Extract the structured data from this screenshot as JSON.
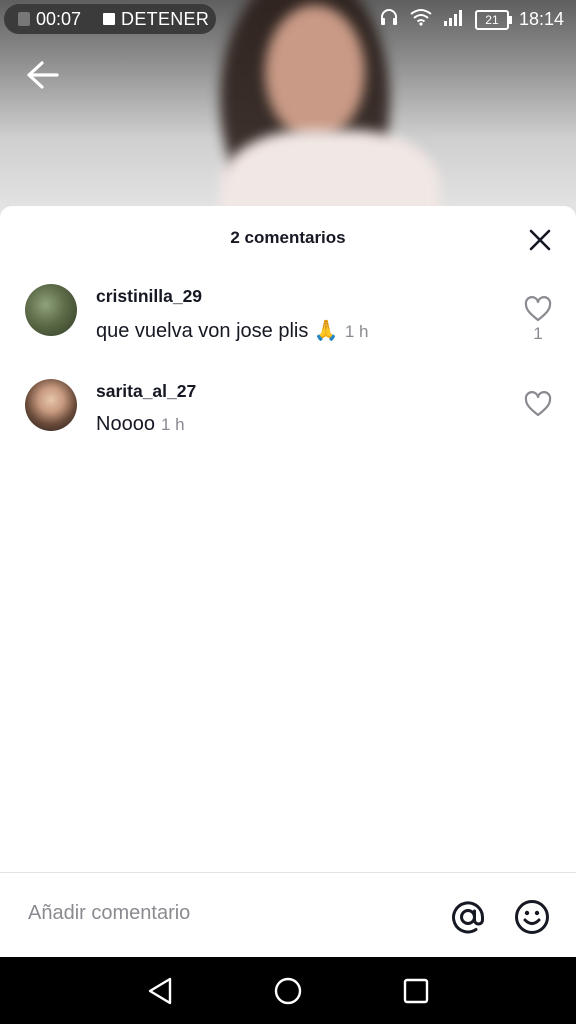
{
  "statusbar": {
    "recording_time": "00:07",
    "stop_label": "DETENER",
    "battery_level": "21",
    "clock": "18:14"
  },
  "sheet": {
    "title": "2 comentarios"
  },
  "comments": [
    {
      "username": "cristinilla_29",
      "text": "que vuelva von jose plis 🙏",
      "time": "1 h",
      "likes": "1"
    },
    {
      "username": "sarita_al_27",
      "text": "Noooo",
      "time": "1 h",
      "likes": ""
    }
  ],
  "input": {
    "placeholder": "Añadir comentario"
  },
  "colors": {
    "text_primary": "#161823",
    "text_secondary": "#8a8b91",
    "navbar": "#000000"
  },
  "icons": [
    "back-arrow-icon",
    "close-icon",
    "heart-icon",
    "at-sign-icon",
    "emoji-icon",
    "nav-back-icon",
    "nav-home-icon",
    "nav-recents-icon"
  ]
}
